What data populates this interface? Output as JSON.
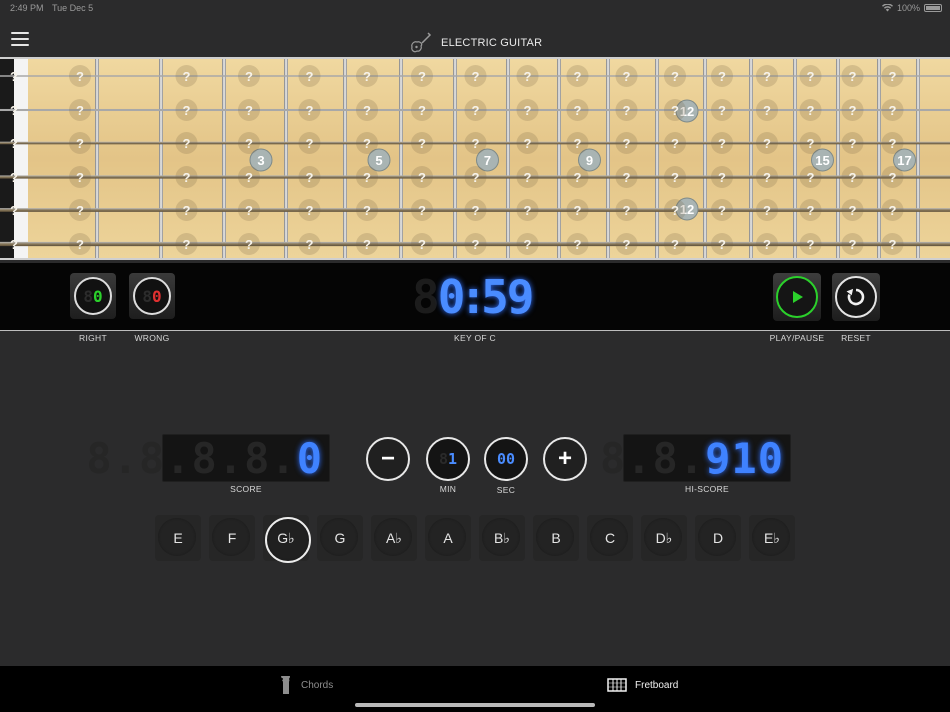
{
  "status_bar": {
    "time": "2:49 PM",
    "date": "Tue Dec 5",
    "battery": "100%"
  },
  "header": {
    "title": "ELECTRIC GUITAR"
  },
  "fretboard": {
    "unknown_marker": "?",
    "fret_markers": [
      "3",
      "5",
      "7",
      "9",
      "12",
      "15",
      "17"
    ]
  },
  "counters": {
    "right": {
      "value": "0",
      "ghost": "8",
      "label": "RIGHT",
      "color": "#2bd12b"
    },
    "wrong": {
      "value": "0",
      "ghost": "8",
      "label": "WRONG",
      "color": "#e03030"
    }
  },
  "timer": {
    "ghost": "8",
    "minutes": "0",
    "colon": ":",
    "seconds": "59",
    "key_label": "KEY OF C"
  },
  "controls": {
    "play_label": "PLAY/PAUSE",
    "reset_label": "RESET"
  },
  "score": {
    "ghost": "8.8.8.8.",
    "value": "0",
    "label": "SCORE"
  },
  "min": {
    "ghost": "8",
    "value": "1",
    "label": "MIN"
  },
  "sec": {
    "value": "00",
    "label": "SEC"
  },
  "hiscore": {
    "ghost": "8.8.",
    "value": "910",
    "label": "HI-SCORE"
  },
  "stepper": {
    "minus": "−",
    "plus": "+"
  },
  "notes": [
    "E",
    "F",
    "G♭",
    "G",
    "A♭",
    "A",
    "B♭",
    "B",
    "C",
    "D♭",
    "D",
    "E♭"
  ],
  "selected_note": "G♭",
  "tabs": [
    {
      "label": "Chords",
      "active": false
    },
    {
      "label": "Fretboard",
      "active": true
    }
  ],
  "colors": {
    "led_blue": "#4a8cff",
    "wood": "#e6c68a",
    "background": "#2b2b2c"
  }
}
